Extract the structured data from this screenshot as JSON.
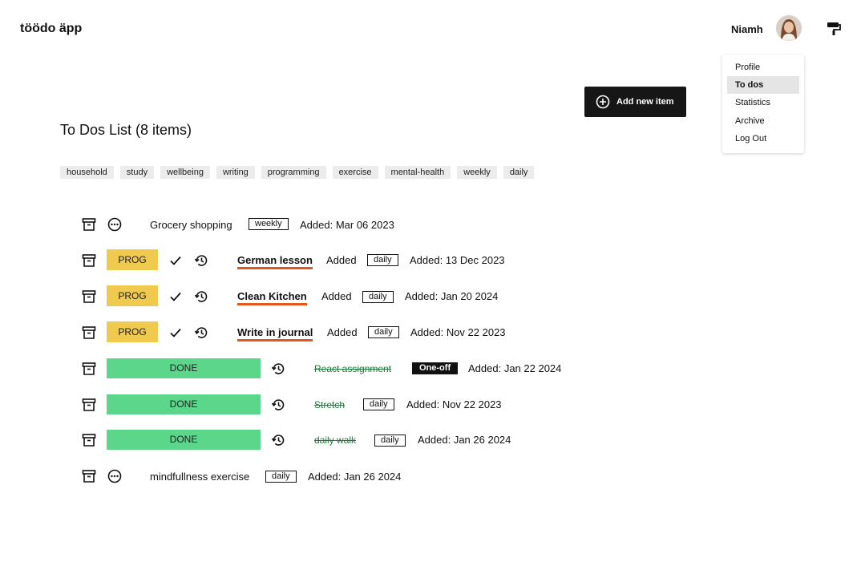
{
  "header": {
    "app_title": "töödo äpp",
    "user_name": "Niamh"
  },
  "menu": {
    "items": [
      {
        "label": "Profile",
        "active": false
      },
      {
        "label": "To dos",
        "active": true
      },
      {
        "label": "Statistics",
        "active": false
      },
      {
        "label": "Archive",
        "active": false
      },
      {
        "label": "Log Out",
        "active": false
      }
    ]
  },
  "toolbar": {
    "add_label": "Add new item"
  },
  "list": {
    "title": "To Dos List (8 items)",
    "tags": [
      "household",
      "study",
      "wellbeing",
      "writing",
      "programming",
      "exercise",
      "mental-health",
      "weekly",
      "daily"
    ]
  },
  "todos": [
    {
      "status": "",
      "name": "Grocery shopping",
      "state_text": "",
      "frequency": "weekly",
      "added": "Added: Mar 06 2023"
    },
    {
      "status": "PROG",
      "name": "German lesson",
      "state_text": "Added",
      "frequency": "daily",
      "added": "Added: 13 Dec 2023"
    },
    {
      "status": "PROG",
      "name": "Clean Kitchen",
      "state_text": "Added",
      "frequency": "daily",
      "added": "Added: Jan 20 2024"
    },
    {
      "status": "PROG",
      "name": "Write in journal",
      "state_text": "Added",
      "frequency": "daily",
      "added": "Added: Nov 22 2023"
    },
    {
      "status": "DONE",
      "name": "React assignment",
      "state_text": "",
      "frequency": "One-off",
      "added": "Added: Jan 22 2024"
    },
    {
      "status": "DONE",
      "name": "Stretch",
      "state_text": "",
      "frequency": "daily",
      "added": "Added: Nov 22 2023"
    },
    {
      "status": "DONE",
      "name": "daily walk",
      "state_text": "",
      "frequency": "daily",
      "added": "Added: Jan 26 2024"
    },
    {
      "status": "",
      "name": "mindfullness exercise",
      "state_text": "",
      "frequency": "daily",
      "added": "Added: Jan 26 2024"
    }
  ],
  "colors": {
    "prog": "#f0c94f",
    "done": "#5bd68a",
    "underline": "#e2571b",
    "button": "#161616"
  },
  "icons": [
    "archive-icon",
    "more-icon",
    "check-icon",
    "history-icon",
    "plus-circle-icon",
    "paint-roller-icon"
  ]
}
